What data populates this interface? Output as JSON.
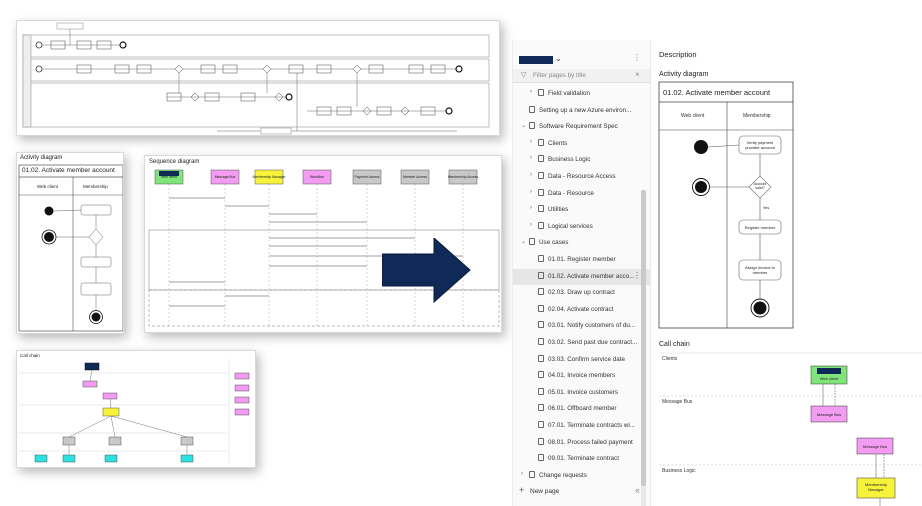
{
  "collage": {
    "activity_card": {
      "heading": "Activity diagram",
      "title": "01.02. Activate member account",
      "lanes": [
        "Web client",
        "Membership"
      ]
    },
    "sequence_card": {
      "heading": "Sequence diagram",
      "participants": [
        "Web client",
        "Message Bus",
        "Membership Manager",
        "Workflow",
        "Payment Access",
        "Member Access",
        "Membership Access"
      ],
      "participant_colors": [
        "#7fe57a",
        "#f29cf2",
        "#f7f33a",
        "#f29cf2",
        "#c8c8c8",
        "#c8c8c8",
        "#c8c8c8"
      ]
    },
    "callchain_card": {
      "heading": "Call chain"
    },
    "arrow_color": "#0f2a57"
  },
  "sidebar": {
    "filter_placeholder": "Filter pages by title",
    "new_page_label": "New page",
    "rows": [
      {
        "label": "Field validation",
        "indent": 1,
        "chevron": "›",
        "selected": false
      },
      {
        "label": "Setting up a new Azure environ...",
        "indent": 0,
        "chevron": "",
        "selected": false
      },
      {
        "label": "Software Requirement Spec",
        "indent": 0,
        "chevron": "⌄",
        "selected": false
      },
      {
        "label": "Clients",
        "indent": 1,
        "chevron": "›",
        "selected": false
      },
      {
        "label": "Business Logic",
        "indent": 1,
        "chevron": "›",
        "selected": false
      },
      {
        "label": "Data - Resource Access",
        "indent": 1,
        "chevron": "›",
        "selected": false
      },
      {
        "label": "Data - Resource",
        "indent": 1,
        "chevron": "›",
        "selected": false
      },
      {
        "label": "Utilities",
        "indent": 1,
        "chevron": "›",
        "selected": false
      },
      {
        "label": "Logical services",
        "indent": 1,
        "chevron": "›",
        "selected": false
      },
      {
        "label": "Use cases",
        "indent": 0,
        "chevron": "⌄",
        "selected": false
      },
      {
        "label": "01.01. Register member",
        "indent": 1,
        "chevron": "",
        "selected": false
      },
      {
        "label": "01.02. Activate member acco...",
        "indent": 1,
        "chevron": "",
        "selected": true
      },
      {
        "label": "02.03. Draw up contract",
        "indent": 1,
        "chevron": "",
        "selected": false
      },
      {
        "label": "02.04. Activate contract",
        "indent": 1,
        "chevron": "",
        "selected": false
      },
      {
        "label": "03.01. Notify customers of du...",
        "indent": 1,
        "chevron": "",
        "selected": false
      },
      {
        "label": "03.02. Send past due contract...",
        "indent": 1,
        "chevron": "",
        "selected": false
      },
      {
        "label": "03.03. Confirm service date",
        "indent": 1,
        "chevron": "",
        "selected": false
      },
      {
        "label": "04.01. Invoice members",
        "indent": 1,
        "chevron": "",
        "selected": false
      },
      {
        "label": "05.01. Invoice customers",
        "indent": 1,
        "chevron": "",
        "selected": false
      },
      {
        "label": "06.01. Offboard member",
        "indent": 1,
        "chevron": "",
        "selected": false
      },
      {
        "label": "07.01. Terminate contracts wi...",
        "indent": 1,
        "chevron": "",
        "selected": false
      },
      {
        "label": "08.01. Process failed payment",
        "indent": 1,
        "chevron": "",
        "selected": false
      },
      {
        "label": "09.01. Terminate contract",
        "indent": 1,
        "chevron": "",
        "selected": false
      },
      {
        "label": "Change requests",
        "indent": 0,
        "chevron": "›",
        "selected": false
      }
    ]
  },
  "page": {
    "description_heading": "Description",
    "activity_heading": "Activity diagram",
    "activity_title": "01.02. Activate member account",
    "lane_web": "Web client",
    "lane_membership": "Membership",
    "node_verify": "Verify payment provider account",
    "node_decision": "Account valid?",
    "node_yes": "Yes",
    "node_register": "Register member",
    "node_assign": "Assign invoice to member",
    "callchain_heading": "Call chain",
    "chain_clients": "Clients",
    "chain_messagebus": "Message Bus",
    "chain_businesslogic": "Business Logic",
    "box_webclient": "Web client",
    "box_messagebus": "Message Bus",
    "box_messagebus2": "Message Bus",
    "box_membership": "Membership Manager"
  }
}
